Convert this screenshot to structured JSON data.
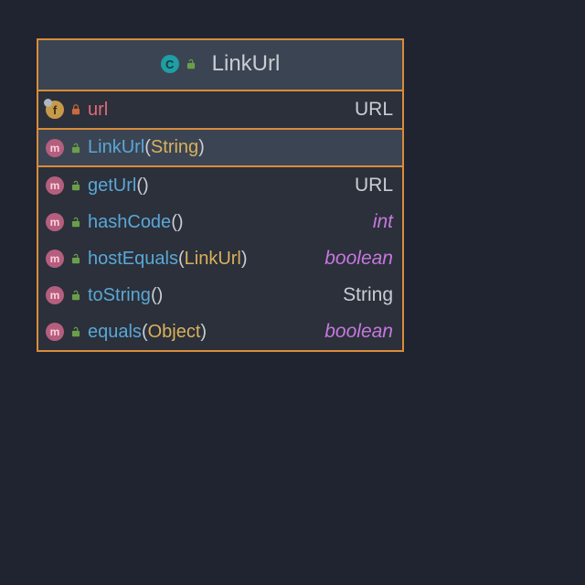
{
  "class": {
    "title": "LinkUrl",
    "icon": "class-icon",
    "visibility": "open"
  },
  "fields": [
    {
      "kind": "field",
      "visibility": "closed",
      "name": "url",
      "params": null,
      "ret": "URL",
      "retPrimitive": false
    }
  ],
  "constructors": [
    {
      "kind": "method",
      "visibility": "open",
      "name": "LinkUrl",
      "params": "String",
      "ret": "",
      "retPrimitive": false,
      "selected": true
    }
  ],
  "methods": [
    {
      "kind": "method",
      "visibility": "open",
      "name": "getUrl",
      "params": "",
      "ret": "URL",
      "retPrimitive": false
    },
    {
      "kind": "method",
      "visibility": "open",
      "name": "hashCode",
      "params": "",
      "ret": "int",
      "retPrimitive": true
    },
    {
      "kind": "method",
      "visibility": "open",
      "name": "hostEquals",
      "params": "LinkUrl",
      "ret": "boolean",
      "retPrimitive": true
    },
    {
      "kind": "method",
      "visibility": "open",
      "name": "toString",
      "params": "",
      "ret": "String",
      "retPrimitive": false
    },
    {
      "kind": "method",
      "visibility": "open",
      "name": "equals",
      "params": "Object",
      "ret": "boolean",
      "retPrimitive": true
    }
  ],
  "glyphs": {
    "class": "C",
    "field": "f",
    "method": "m"
  }
}
